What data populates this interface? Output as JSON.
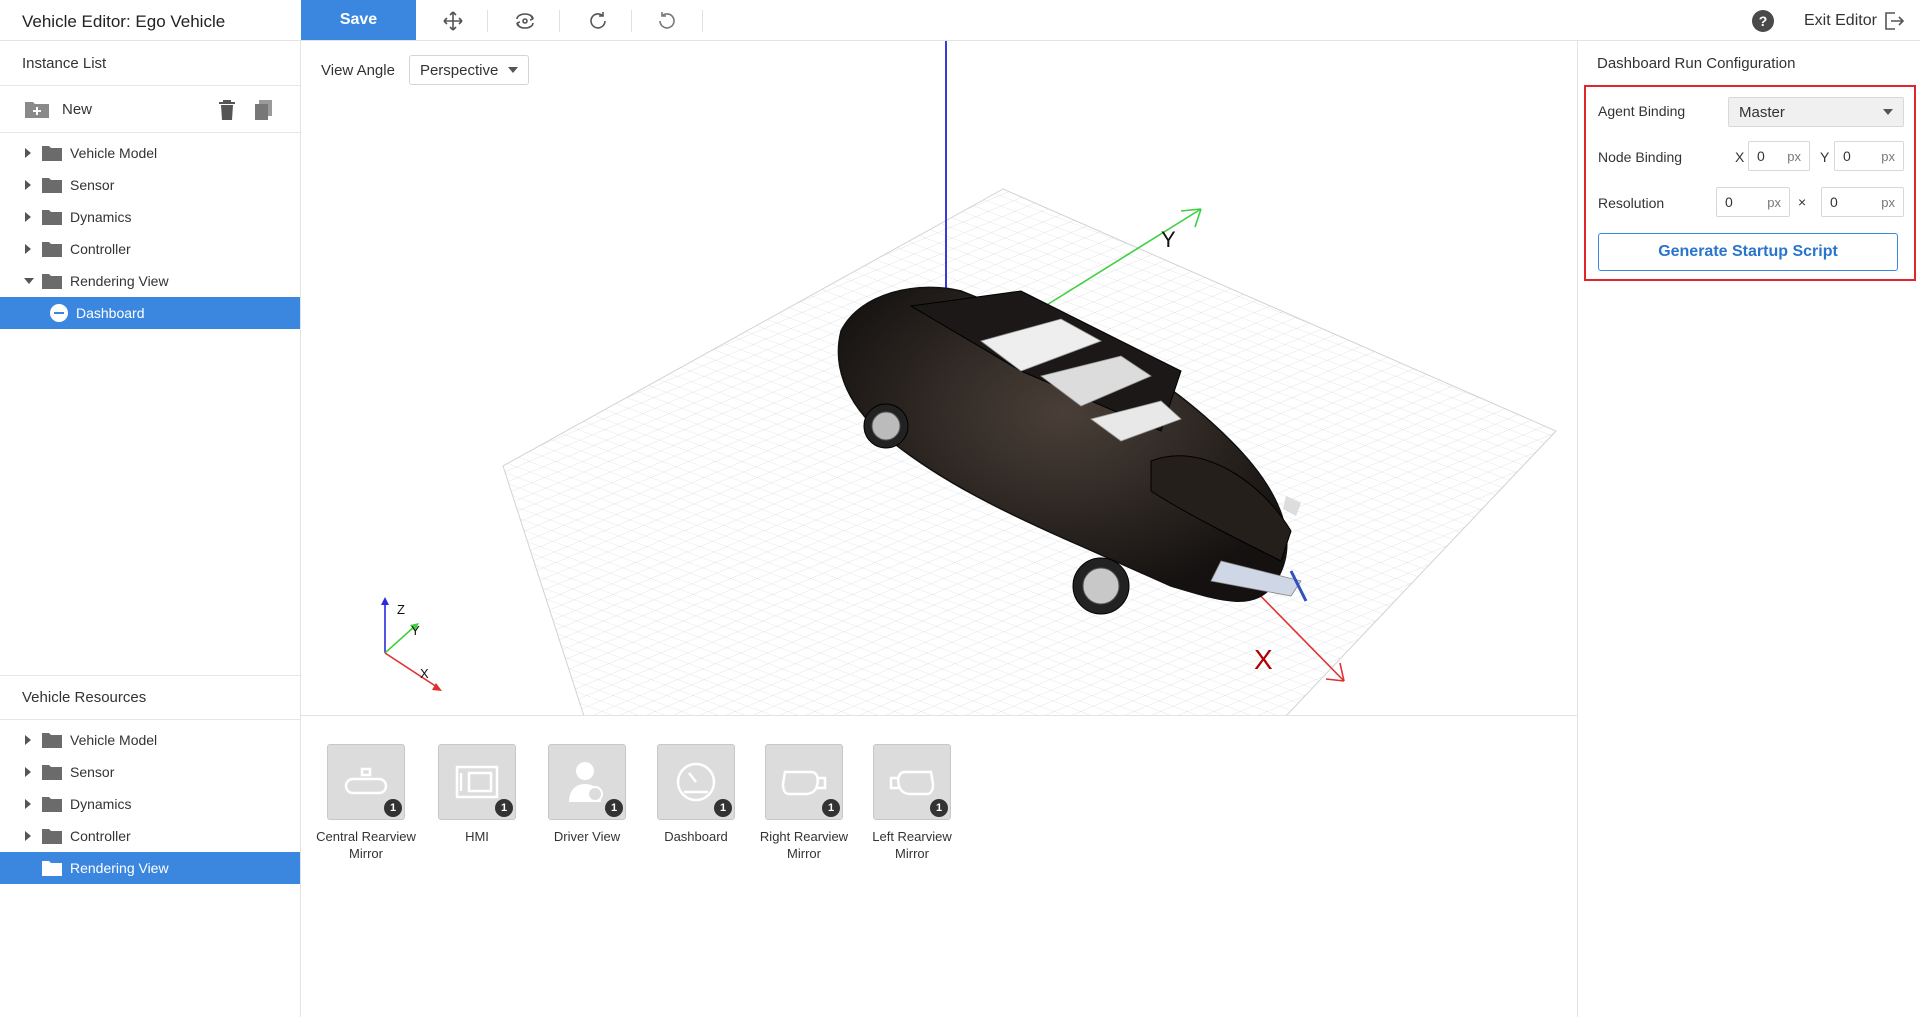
{
  "app": {
    "title": "Vehicle Editor: Ego Vehicle"
  },
  "toolbar": {
    "save_label": "Save",
    "tools": [
      "move-icon",
      "rotate-view-icon",
      "redo-icon",
      "undo-icon"
    ],
    "help_label": "?",
    "exit_label": "Exit Editor"
  },
  "instance_list": {
    "title": "Instance List",
    "new_label": "New",
    "items": [
      {
        "label": "Vehicle Model",
        "expanded": false
      },
      {
        "label": "Sensor",
        "expanded": false
      },
      {
        "label": "Dynamics",
        "expanded": false
      },
      {
        "label": "Controller",
        "expanded": false
      },
      {
        "label": "Rendering View",
        "expanded": true
      }
    ],
    "selected_child": "Dashboard"
  },
  "viewport": {
    "view_angle_label": "View Angle",
    "view_angle_value": "Perspective",
    "axis_labels": {
      "x": "X",
      "y": "Y",
      "z": "Z"
    }
  },
  "vehicle_resources": {
    "title": "Vehicle Resources",
    "items": [
      {
        "label": "Vehicle Model"
      },
      {
        "label": "Sensor"
      },
      {
        "label": "Dynamics"
      },
      {
        "label": "Controller"
      },
      {
        "label": "Rendering View"
      }
    ],
    "tiles": [
      {
        "label_1": "Central Rearview",
        "label_2": "Mirror",
        "count": "1",
        "icon": "rearview-mirror-icon"
      },
      {
        "label_1": "HMI",
        "label_2": "",
        "count": "1",
        "icon": "hmi-screen-icon"
      },
      {
        "label_1": "Driver View",
        "label_2": "",
        "count": "1",
        "icon": "driver-icon"
      },
      {
        "label_1": "Dashboard",
        "label_2": "",
        "count": "1",
        "icon": "gauge-icon"
      },
      {
        "label_1": "Right Rearview",
        "label_2": "Mirror",
        "count": "1",
        "icon": "side-mirror-icon"
      },
      {
        "label_1": "Left Rearview",
        "label_2": "Mirror",
        "count": "1",
        "icon": "side-mirror-icon"
      }
    ]
  },
  "run_config": {
    "title": "Dashboard Run Configuration",
    "agent_binding_label": "Agent Binding",
    "agent_binding_value": "Master",
    "node_binding_label": "Node Binding",
    "node_x_label": "X",
    "node_x_value": "0",
    "node_y_label": "Y",
    "node_y_value": "0",
    "resolution_label": "Resolution",
    "resolution_w": "0",
    "resolution_h": "0",
    "times_symbol": "×",
    "unit": "px",
    "generate_label": "Generate Startup Script"
  },
  "colors": {
    "accent": "#3b87e0",
    "highlight_border": "#e0262b"
  }
}
